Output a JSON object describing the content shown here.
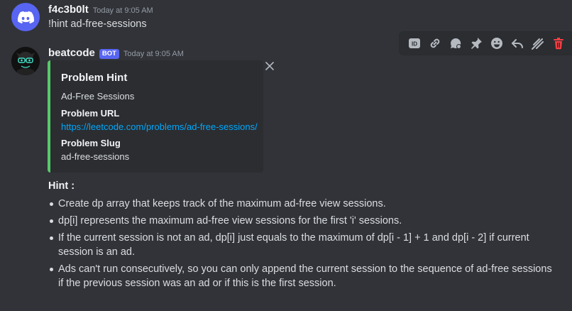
{
  "messages": [
    {
      "username": "f4c3b0lt",
      "timestamp": "Today at 9:05 AM",
      "text": "!hint ad-free-sessions",
      "avatar_color": "#5865f2"
    },
    {
      "username": "beatcode",
      "badge": "BOT",
      "timestamp": "Today at 9:05 AM",
      "embed": {
        "accent_color": "#57c96a",
        "title": "Problem Hint",
        "description": "Ad-Free Sessions",
        "fields": [
          {
            "name": "Problem URL",
            "value": "https://leetcode.com/problems/ad-free-sessions/"
          },
          {
            "name": "Problem Slug",
            "value": "ad-free-sessions"
          }
        ]
      },
      "hint_label": "Hint :",
      "hints": [
        "Create dp array that keeps track of the maximum ad-free view sessions.",
        "dp[i] represents the maximum ad-free view sessions for the first 'i' sessions.",
        "If the current session is not an ad, dp[i] just equals to the maximum of dp[i - 1] + 1 and dp[i - 2] if current session is an ad.",
        "Ads can't run consecutively, so you can only append the current session to the sequence of ad-free sessions if the previous session was an ad or if this is the first session."
      ]
    }
  ],
  "toolbar": [
    {
      "icon": "id-icon"
    },
    {
      "icon": "link-icon"
    },
    {
      "icon": "thread-icon"
    },
    {
      "icon": "pin-icon"
    },
    {
      "icon": "emoji-icon"
    },
    {
      "icon": "reply-icon"
    },
    {
      "icon": "mark-unread-icon"
    },
    {
      "icon": "trash-icon"
    }
  ]
}
